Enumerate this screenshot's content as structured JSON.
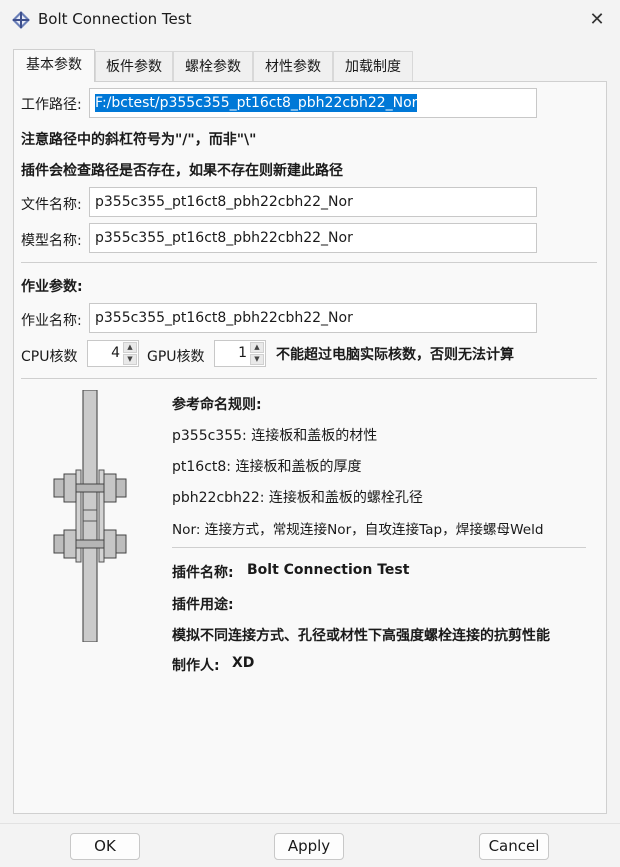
{
  "window": {
    "title": "Bolt Connection Test",
    "close_glyph": "✕"
  },
  "tabs": [
    {
      "label": "基本参数",
      "active": true
    },
    {
      "label": "板件参数"
    },
    {
      "label": "螺栓参数"
    },
    {
      "label": "材性参数"
    },
    {
      "label": "加载制度"
    }
  ],
  "basic": {
    "path_label": "工作路径:",
    "path_value": "F:/bctest/p355c355_pt16ct8_pbh22cbh22_Nor",
    "note1": "注意路径中的斜杠符号为\"/\"，而非\"\\\"",
    "note2": "插件会检查路径是否存在，如果不存在则新建此路径",
    "file_label": "文件名称:",
    "file_value": "p355c355_pt16ct8_pbh22cbh22_Nor",
    "model_label": "模型名称:",
    "model_value": "p355c355_pt16ct8_pbh22cbh22_Nor"
  },
  "job": {
    "heading": "作业参数:",
    "name_label": "作业名称:",
    "name_value": "p355c355_pt16ct8_pbh22cbh22_Nor",
    "cpu_label": "CPU核数",
    "cpu_value": "4",
    "gpu_label": "GPU核数",
    "gpu_value": "1",
    "warning": "不能超过电脑实际核数，否则无法计算"
  },
  "naming": {
    "heading": "参考命名规则:",
    "rules": [
      "p355c355: 连接板和盖板的材性",
      "pt16ct8: 连接板和盖板的厚度",
      "pbh22cbh22: 连接板和盖板的螺栓孔径",
      "Nor: 连接方式，常规连接Nor，自攻连接Tap，焊接螺母Weld"
    ]
  },
  "plugin": {
    "name_label": "插件名称:",
    "name_value": "Bolt Connection Test",
    "purpose_label": "插件用途:",
    "purpose_value": "模拟不同连接方式、孔径或材性下高强度螺栓连接的抗剪性能",
    "author_label": "制作人:",
    "author_value": "XD"
  },
  "buttons": {
    "ok": "OK",
    "apply": "Apply",
    "cancel": "Cancel"
  },
  "icons": {
    "app": "app-diamond-icon",
    "close": "close-icon",
    "spin_up": "chevron-up-icon",
    "spin_down": "chevron-down-icon",
    "illustration": "bolt-connection-diagram"
  },
  "colors": {
    "selection": "#0078d7",
    "window_bg": "#f3f3f3",
    "panel_bg": "#f9f9f9",
    "steel": "#c8c8c8"
  }
}
